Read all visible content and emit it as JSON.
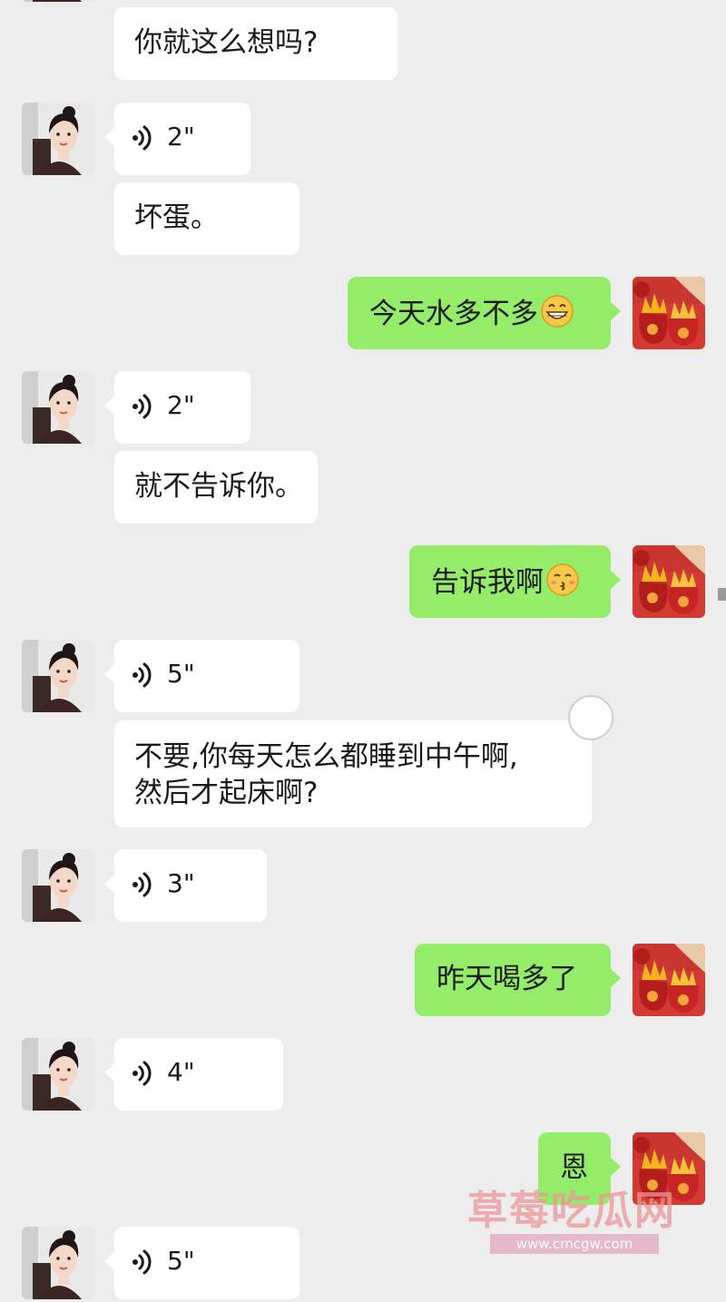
{
  "messages": [
    {
      "side": "in",
      "kind": "text",
      "text": "你就这么想吗?"
    },
    {
      "side": "in",
      "kind": "voice",
      "duration": "2\""
    },
    {
      "side": "in",
      "kind": "text",
      "text": "坏蛋。"
    },
    {
      "side": "out",
      "kind": "text",
      "text": "今天水多不多",
      "emoji": "grin-emoji"
    },
    {
      "side": "in",
      "kind": "voice",
      "duration": "2\""
    },
    {
      "side": "in",
      "kind": "text",
      "text": "就不告诉你。"
    },
    {
      "side": "out",
      "kind": "text",
      "text": "告诉我啊",
      "emoji": "kiss-emoji"
    },
    {
      "side": "in",
      "kind": "voice",
      "duration": "5\""
    },
    {
      "side": "in",
      "kind": "text",
      "text": "不要,你每天怎么都睡到中午啊,",
      "text2": "然后才起床啊?"
    },
    {
      "side": "in",
      "kind": "voice",
      "duration": "3\""
    },
    {
      "side": "out",
      "kind": "text",
      "text": "昨天喝多了"
    },
    {
      "side": "in",
      "kind": "voice",
      "duration": "4\""
    },
    {
      "side": "out",
      "kind": "text",
      "text": "恩"
    },
    {
      "side": "in",
      "kind": "voice",
      "duration": "5\""
    }
  ],
  "watermark": {
    "name": "草莓吃瓜网",
    "url": "www.cmcgw.com"
  },
  "colors": {
    "background": "#ededed",
    "incoming_bubble": "#ffffff",
    "outgoing_bubble": "#95ec69"
  },
  "icons": {
    "voice": "voice-wave-icon",
    "contact_avatar": "girl-avatar",
    "self_avatar": "money-bag-avatar"
  }
}
